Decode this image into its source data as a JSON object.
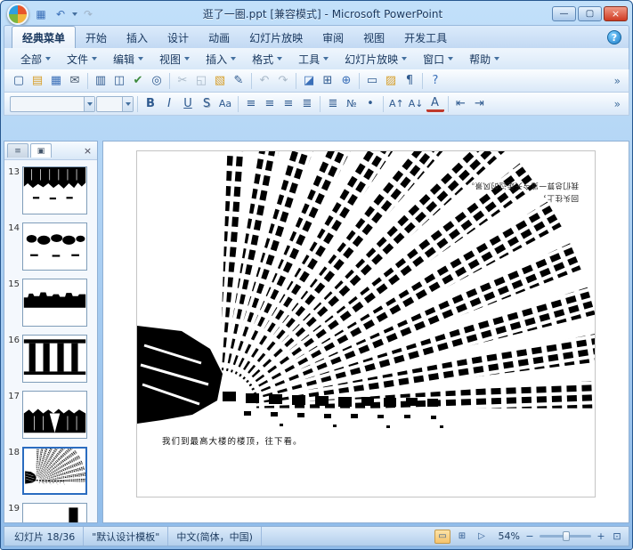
{
  "titlebar": {
    "title": "逛了一圈.ppt [兼容模式] - Microsoft PowerPoint",
    "qat": [
      {
        "name": "save",
        "glyph": "▦"
      },
      {
        "name": "undo",
        "glyph": "↶"
      },
      {
        "name": "redo",
        "glyph": "↷"
      }
    ],
    "window_controls": [
      {
        "name": "minimize",
        "glyph": "—"
      },
      {
        "name": "maximize",
        "glyph": "▢"
      },
      {
        "name": "close",
        "glyph": "×"
      }
    ]
  },
  "ribbon": {
    "tabs": [
      {
        "label": "经典菜单"
      },
      {
        "label": "开始"
      },
      {
        "label": "插入"
      },
      {
        "label": "设计"
      },
      {
        "label": "动画"
      },
      {
        "label": "幻灯片放映"
      },
      {
        "label": "审阅"
      },
      {
        "label": "视图"
      },
      {
        "label": "开发工具"
      }
    ],
    "active_tab": "经典菜单",
    "help_glyph": "?"
  },
  "menubar": [
    {
      "label": "全部"
    },
    {
      "label": "文件"
    },
    {
      "label": "编辑"
    },
    {
      "label": "视图"
    },
    {
      "label": "插入"
    },
    {
      "label": "格式"
    },
    {
      "label": "工具"
    },
    {
      "label": "幻灯片放映"
    },
    {
      "label": "窗口"
    },
    {
      "label": "帮助"
    }
  ],
  "toolbar1": [
    {
      "name": "new-presentation",
      "glyph": "▢"
    },
    {
      "name": "open",
      "glyph": "▤"
    },
    {
      "name": "save",
      "glyph": "▦"
    },
    {
      "name": "email",
      "glyph": "✉"
    },
    {
      "name": "print",
      "glyph": "▥"
    },
    {
      "name": "print-preview",
      "glyph": "◫"
    },
    {
      "name": "spelling",
      "glyph": "✔"
    },
    {
      "name": "research",
      "glyph": "◎"
    },
    {
      "name": "cut",
      "glyph": "✂"
    },
    {
      "name": "copy",
      "glyph": "◱"
    },
    {
      "name": "paste",
      "glyph": "▧"
    },
    {
      "name": "format-painter",
      "glyph": "✎"
    },
    {
      "name": "undo",
      "glyph": "↶"
    },
    {
      "name": "redo",
      "glyph": "↷"
    },
    {
      "name": "insert-chart",
      "glyph": "◪"
    },
    {
      "name": "insert-table",
      "glyph": "⊞"
    },
    {
      "name": "hyperlink",
      "glyph": "⊕"
    },
    {
      "name": "new-slide",
      "glyph": "▭"
    },
    {
      "name": "slide-design",
      "glyph": "▨"
    },
    {
      "name": "formatting-marks",
      "glyph": "¶"
    },
    {
      "name": "toolbar-help",
      "glyph": "?"
    }
  ],
  "toolbar1_overflow": "»",
  "toolbar2": {
    "font_combo_value": "",
    "size_combo_value": "",
    "buttons": [
      {
        "name": "bold",
        "glyph": "B"
      },
      {
        "name": "italic",
        "glyph": "I"
      },
      {
        "name": "underline",
        "glyph": "U"
      },
      {
        "name": "shadow",
        "glyph": "S"
      },
      {
        "name": "change-case",
        "glyph": "Aa"
      },
      {
        "name": "align-left",
        "glyph": "≡"
      },
      {
        "name": "align-center",
        "glyph": "≡"
      },
      {
        "name": "align-right",
        "glyph": "≡"
      },
      {
        "name": "justify",
        "glyph": "≣"
      },
      {
        "name": "line-spacing",
        "glyph": "≣"
      },
      {
        "name": "numbering",
        "glyph": "№"
      },
      {
        "name": "bullets",
        "glyph": "•"
      },
      {
        "name": "increase-font-size",
        "glyph": "A↑"
      },
      {
        "name": "decrease-font-size",
        "glyph": "A↓"
      },
      {
        "name": "font-color",
        "glyph": "A"
      },
      {
        "name": "decrease-indent",
        "glyph": "⇤"
      },
      {
        "name": "increase-indent",
        "glyph": "⇥"
      }
    ]
  },
  "toolbar2_overflow": "»",
  "slides_panel": {
    "outline_tab_glyph": "≡",
    "slides_tab_glyph": "▣",
    "close_glyph": "×",
    "slides": [
      {
        "number": "13"
      },
      {
        "number": "14"
      },
      {
        "number": "15"
      },
      {
        "number": "16"
      },
      {
        "number": "17"
      },
      {
        "number": "18",
        "current": true
      },
      {
        "number": "19"
      }
    ]
  },
  "slide": {
    "caption": "我们到最高大楼的楼顶，往下看。",
    "flipped_line1": "回头往上，",
    "flipped_line2": "我们总算一览今天走过的风景。"
  },
  "statusbar": {
    "slide_indicator": "幻灯片 18/36",
    "theme": "\"默认设计模板\"",
    "language": "中文(简体，中国)",
    "views": [
      {
        "name": "normal-view",
        "glyph": "▭"
      },
      {
        "name": "slide-sorter-view",
        "glyph": "⊞"
      },
      {
        "name": "slideshow-view",
        "glyph": "▷"
      }
    ],
    "zoom": "54%",
    "zoom_out_glyph": "−",
    "zoom_in_glyph": "+",
    "fit_glyph": "⊡"
  }
}
